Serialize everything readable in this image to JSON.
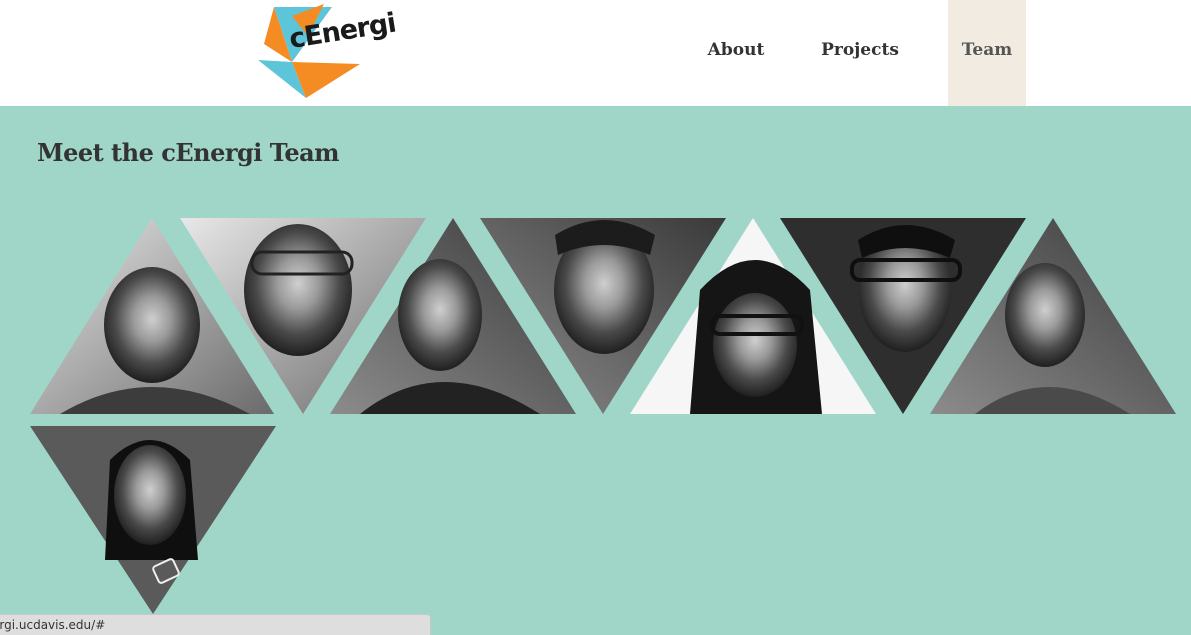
{
  "header": {
    "logo_text": "cEnergi",
    "logo_colors": {
      "orange": "#f58b23",
      "blue": "#5cc5d9"
    }
  },
  "nav": {
    "items": [
      {
        "label": "About",
        "active": false
      },
      {
        "label": "Projects",
        "active": false
      },
      {
        "label": "Team",
        "active": true
      }
    ]
  },
  "main": {
    "title": "Meet the cEnergi Team",
    "members": [
      {
        "name": "team-member-1",
        "photo_icon": "portrait-photo"
      },
      {
        "name": "team-member-2",
        "photo_icon": "portrait-photo"
      },
      {
        "name": "team-member-3",
        "photo_icon": "portrait-photo"
      },
      {
        "name": "team-member-4",
        "photo_icon": "portrait-photo"
      },
      {
        "name": "team-member-5",
        "photo_icon": "portrait-photo"
      },
      {
        "name": "team-member-6",
        "photo_icon": "portrait-photo"
      },
      {
        "name": "team-member-7",
        "photo_icon": "portrait-photo"
      },
      {
        "name": "team-member-8",
        "photo_icon": "portrait-photo"
      }
    ]
  },
  "status_bar": {
    "url": "ergi.ucdavis.edu/#"
  },
  "colors": {
    "background": "#9fd6c8",
    "header": "#ffffff",
    "active_tab": "#f1ebe2",
    "text": "#333333"
  }
}
